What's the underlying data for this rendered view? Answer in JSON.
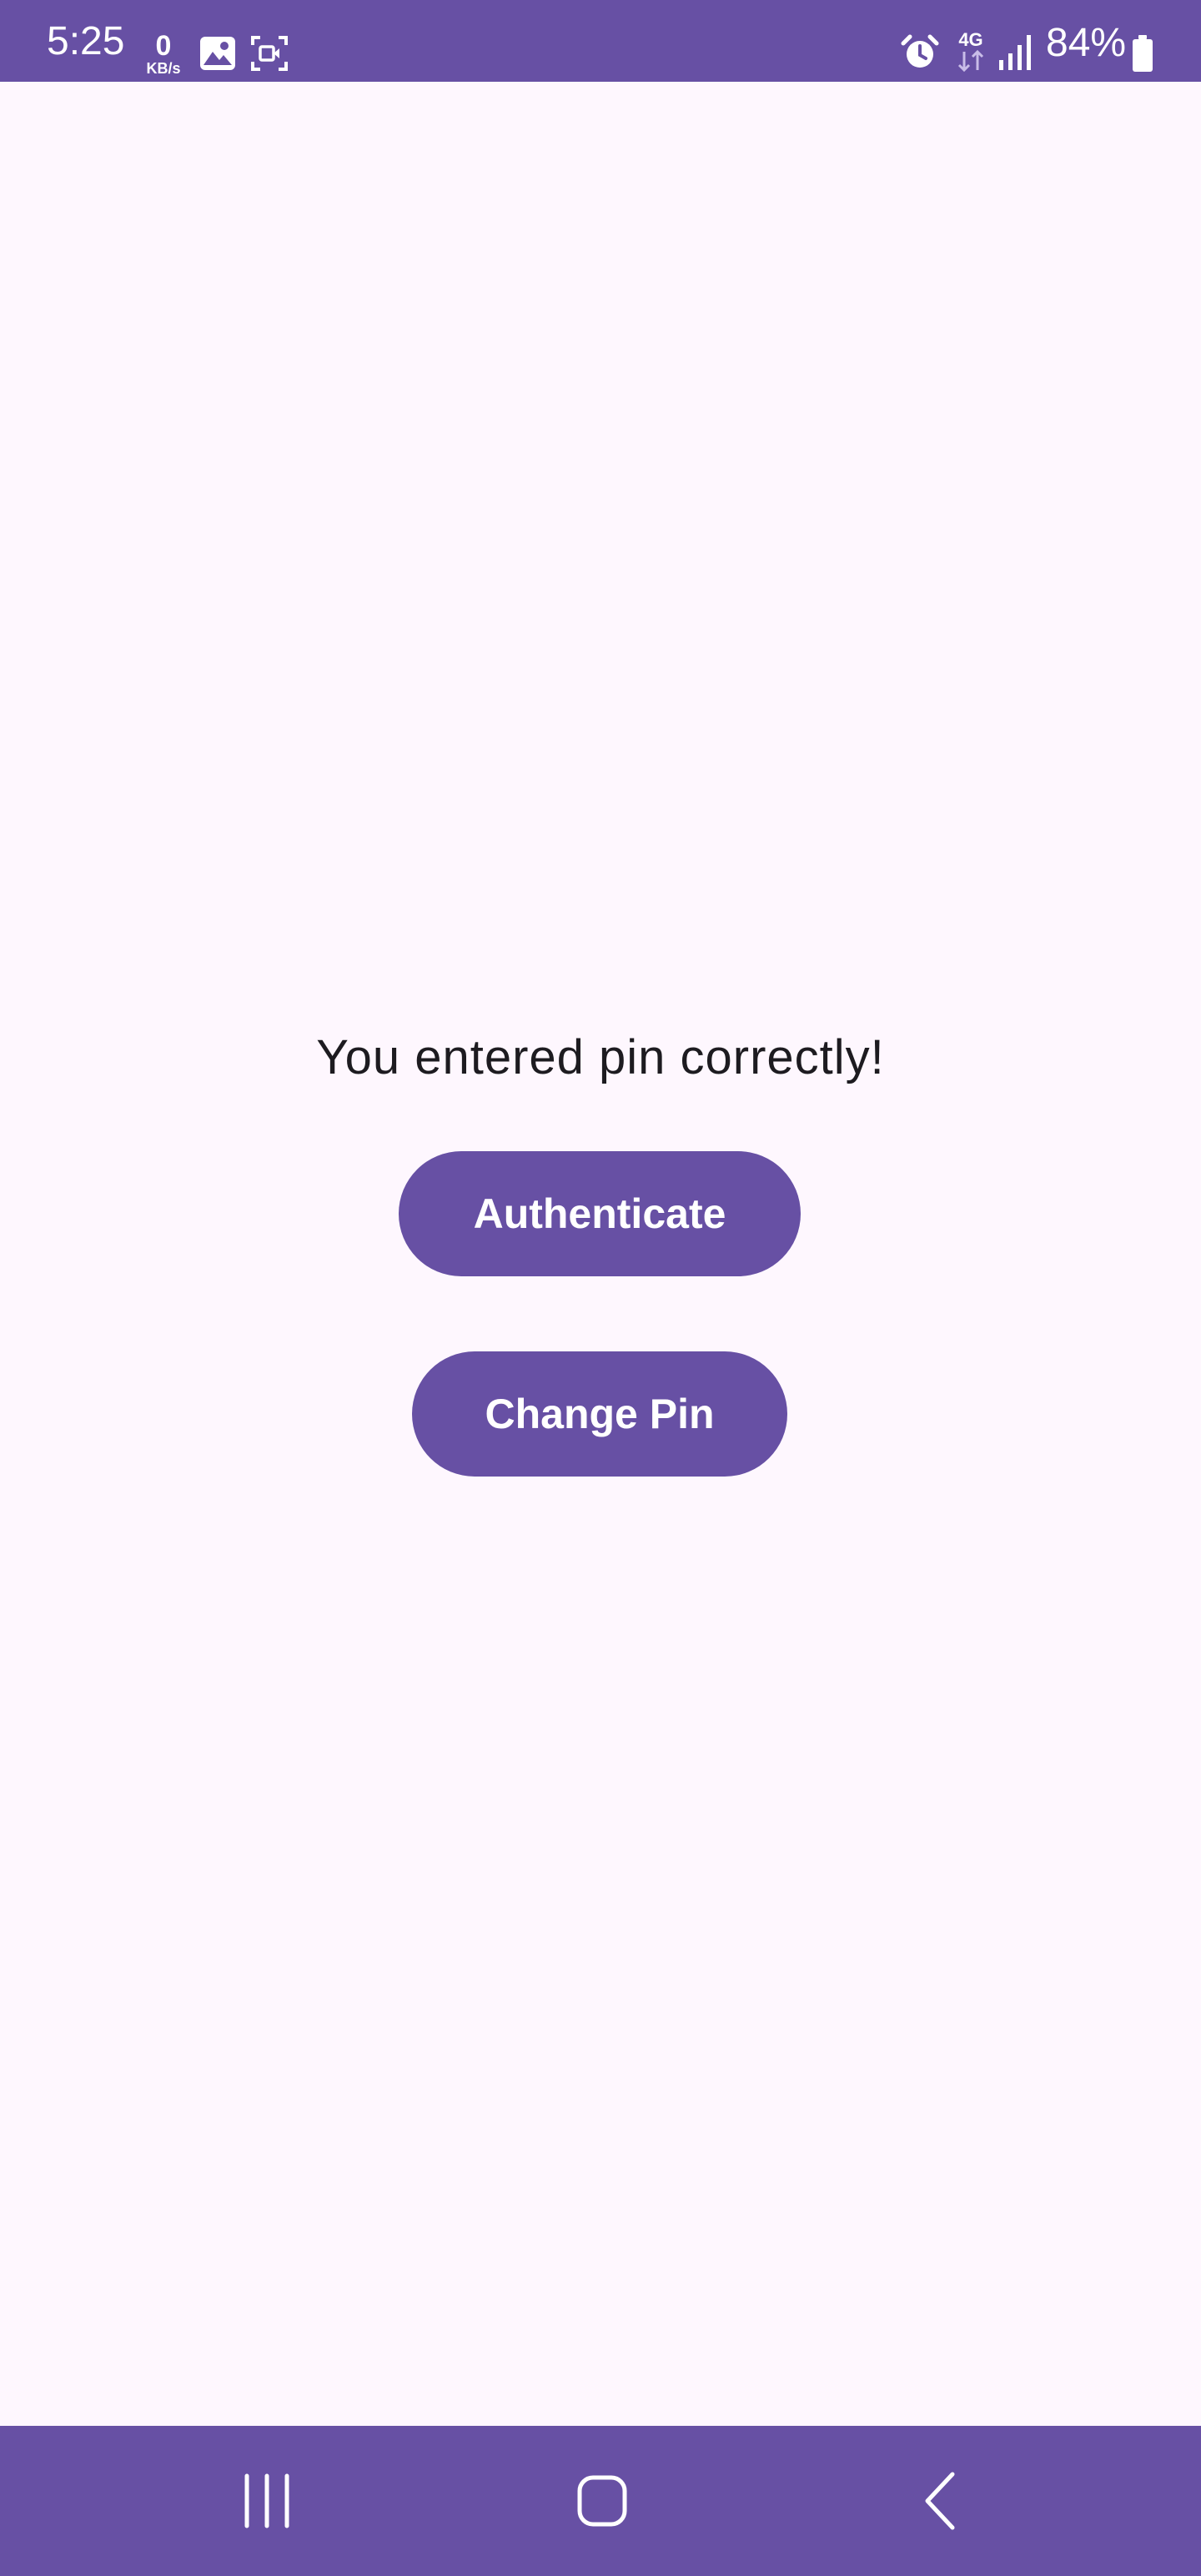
{
  "status_bar": {
    "time": "5:25",
    "net_speed_value": "0",
    "net_speed_unit": "KB/s",
    "network_type": "4G",
    "battery_percent": "84%",
    "left_icons": [
      "gallery-icon",
      "screen-record-icon"
    ],
    "right_icons": [
      "alarm-icon",
      "4g-data-icon",
      "signal-icon",
      "battery-icon"
    ]
  },
  "main": {
    "message": "You entered pin correctly!",
    "authenticate_label": "Authenticate",
    "change_pin_label": "Change Pin"
  },
  "nav_bar": {
    "buttons": [
      "recent-apps-icon",
      "home-icon",
      "back-icon"
    ]
  },
  "colors": {
    "primary": "#6750A4",
    "background": "#FEF7FE",
    "text": "#1D1B20",
    "on_primary": "#FFFFFF"
  }
}
